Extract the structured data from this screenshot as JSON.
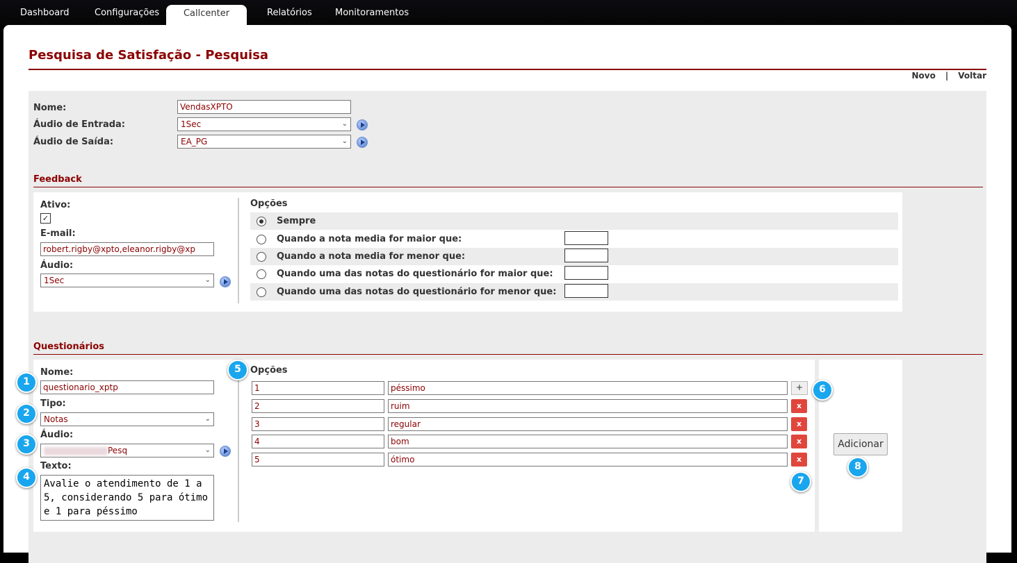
{
  "nav": {
    "tabs": [
      {
        "label": "Dashboard"
      },
      {
        "label": "Configurações"
      },
      {
        "label": "Callcenter"
      },
      {
        "label": "Relatórios"
      },
      {
        "label": "Monitoramentos"
      }
    ]
  },
  "page": {
    "title": "Pesquisa de Satisfação - Pesquisa",
    "link_novo": "Novo",
    "link_sep": "|",
    "link_voltar": "Voltar"
  },
  "form": {
    "nome_label": "Nome:",
    "nome_value": "VendasXPTO",
    "audio_entrada_label": "Áudio de Entrada:",
    "audio_entrada_value": "1Sec",
    "audio_saida_label": "Áudio de Saída:",
    "audio_saida_value": "EA_PG"
  },
  "feedback": {
    "heading": "Feedback",
    "ativo_label": "Ativo:",
    "ativo_checked": "✓",
    "email_label": "E-mail:",
    "email_value": "robert.rigby@xpto,eleanor.rigby@xp",
    "audio_label": "Áudio:",
    "audio_value": "1Sec",
    "options_heading": "Opções",
    "options": [
      {
        "label": "Sempre",
        "selected": true
      },
      {
        "label": "Quando a nota media for maior que:",
        "selected": false
      },
      {
        "label": "Quando a nota media for menor que:",
        "selected": false
      },
      {
        "label": "Quando uma das notas do questionário for maior que:",
        "selected": false
      },
      {
        "label": "Quando uma das notas do questionário for menor que:",
        "selected": false
      }
    ]
  },
  "questionarios": {
    "heading": "Questionários",
    "nome_label": "Nome:",
    "nome_value": "questionario_xptp",
    "tipo_label": "Tipo:",
    "tipo_value": "Notas",
    "audio_label": "Áudio:",
    "audio_value": "Pesq",
    "texto_label": "Texto:",
    "texto_value": "Avalie o atendimento de 1 a 5, considerando 5 para ótimo e 1 para péssimo",
    "options_heading": "Opções",
    "options": [
      {
        "value": "1",
        "label": "péssimo"
      },
      {
        "value": "2",
        "label": "ruim"
      },
      {
        "value": "3",
        "label": "regular"
      },
      {
        "value": "4",
        "label": "bom"
      },
      {
        "value": "5",
        "label": "ótimo"
      }
    ],
    "plus_label": "+",
    "remove_label": "x",
    "add_button": "Adicionar"
  },
  "callouts": [
    "1",
    "2",
    "3",
    "4",
    "5",
    "6",
    "7",
    "8"
  ],
  "colors": {
    "accent": "#8b0000",
    "callout": "#19a6ee",
    "remove": "#e0463c"
  }
}
